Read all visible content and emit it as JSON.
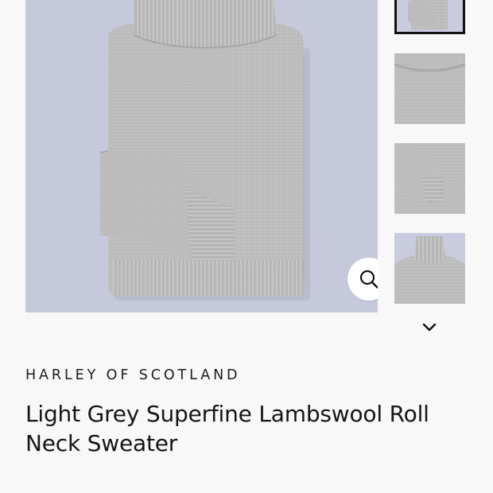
{
  "product": {
    "brand": "HARLEY OF SCOTLAND",
    "title": "Light Grey Superfine Lambswool Roll Neck Sweater",
    "image_alt": "Light grey roll neck sweater folded"
  },
  "gallery": {
    "background_color": "#c6c9dc",
    "zoom_icon": "magnifier-icon",
    "scroll_icon": "chevron-down-icon",
    "thumbnails": [
      {
        "label": "Folded sweater view",
        "active": true
      },
      {
        "label": "Shoulder detail view",
        "active": false
      },
      {
        "label": "Cuff detail view",
        "active": false
      },
      {
        "label": "Roll neck detail view",
        "active": false
      }
    ]
  },
  "colors": {
    "sweater": "#b9b9b9",
    "page_bg": "#f8f8f8",
    "text": "#1a1a1a"
  }
}
